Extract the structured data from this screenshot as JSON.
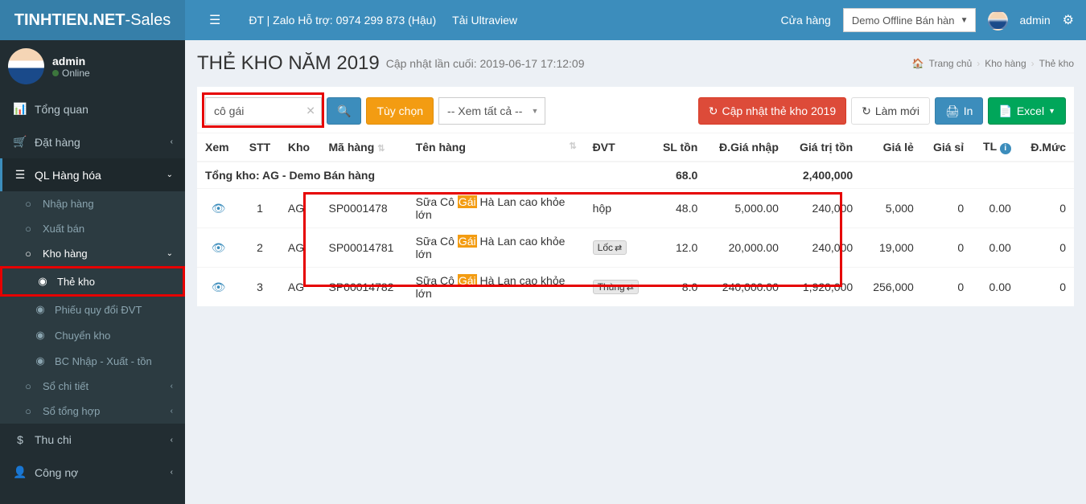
{
  "brand": {
    "bold": "TINHTIEN.NET",
    "light": "-Sales"
  },
  "header": {
    "support": "ĐT | Zalo Hỗ trợ: 0974 299 873 (Hậu)",
    "download": "Tải Ultraview",
    "store_label": "Cửa hàng",
    "store_selected": "Demo Offline Bán hàn",
    "username": "admin"
  },
  "user_panel": {
    "name": "admin",
    "status": "Online"
  },
  "sidebar": {
    "tongquan": "Tổng quan",
    "dathang": "Đặt hàng",
    "qlhanghoa": "QL Hàng hóa",
    "nhaphang": "Nhập hàng",
    "xuatban": "Xuất bán",
    "khohang": "Kho hàng",
    "thekho": "Thẻ kho",
    "phieuquydoi": "Phiếu quy đổi ĐVT",
    "chuyenkho": "Chuyển kho",
    "bcnhapxuat": "BC Nhập - Xuất - tồn",
    "sochitiet": "Sổ chi tiết",
    "sotonghop": "Sổ tổng hợp",
    "thuchi": "Thu chi",
    "congno": "Công nợ"
  },
  "page": {
    "title": "THẺ KHO NĂM 2019",
    "subtitle": "Cập nhật lần cuối: 2019-06-17 17:12:09"
  },
  "breadcrumb": {
    "home": "Trang chủ",
    "b1": "Kho hàng",
    "b2": "Thẻ kho"
  },
  "toolbar": {
    "search_value": "cô gái",
    "tuychon": "Tùy chọn",
    "xemtatca": "-- Xem tất cả --",
    "capnhat": "Cập nhật thẻ kho 2019",
    "lammoi": "Làm mới",
    "in": "In",
    "excel": "Excel"
  },
  "columns": {
    "xem": "Xem",
    "stt": "STT",
    "kho": "Kho",
    "mahang": "Mã hàng",
    "tenhang": "Tên hàng",
    "dvt": "ĐVT",
    "slton": "SL tồn",
    "dgianhap": "Đ.Giá nhập",
    "giatriton": "Giá trị tồn",
    "giale": "Giá lẻ",
    "giasi": "Giá sỉ",
    "tl": "TL",
    "dmuc": "Đ.Mức"
  },
  "group": {
    "label_prefix": "Tổng kho: ",
    "label_name": "AG - Demo Bán hàng",
    "slton": "68.0",
    "giatriton": "2,400,000"
  },
  "rows": [
    {
      "stt": "1",
      "kho": "AG",
      "ma": "SP0001478",
      "ten_pre": "Sữa Cô ",
      "ten_hl": "Gái",
      "ten_post": " Hà Lan cao khỏe lớn",
      "dvt": "hộp",
      "dvt_badge": false,
      "sl": "48.0",
      "dgia": "5,000.00",
      "giatri": "240,000",
      "giale": "5,000",
      "giasi": "0",
      "tl": "0.00",
      "dmuc": "0"
    },
    {
      "stt": "2",
      "kho": "AG",
      "ma": "SP00014781",
      "ten_pre": "Sữa Cô ",
      "ten_hl": "Gái",
      "ten_post": " Hà Lan cao khỏe lớn",
      "dvt": "Lốc",
      "dvt_badge": true,
      "sl": "12.0",
      "dgia": "20,000.00",
      "giatri": "240,000",
      "giale": "19,000",
      "giasi": "0",
      "tl": "0.00",
      "dmuc": "0"
    },
    {
      "stt": "3",
      "kho": "AG",
      "ma": "SP00014782",
      "ten_pre": "Sữa Cô ",
      "ten_hl": "Gái",
      "ten_post": " Hà Lan cao khỏe lớn",
      "dvt": "Thùng",
      "dvt_badge": true,
      "sl": "8.0",
      "dgia": "240,000.00",
      "giatri": "1,920,000",
      "giale": "256,000",
      "giasi": "0",
      "tl": "0.00",
      "dmuc": "0"
    }
  ]
}
